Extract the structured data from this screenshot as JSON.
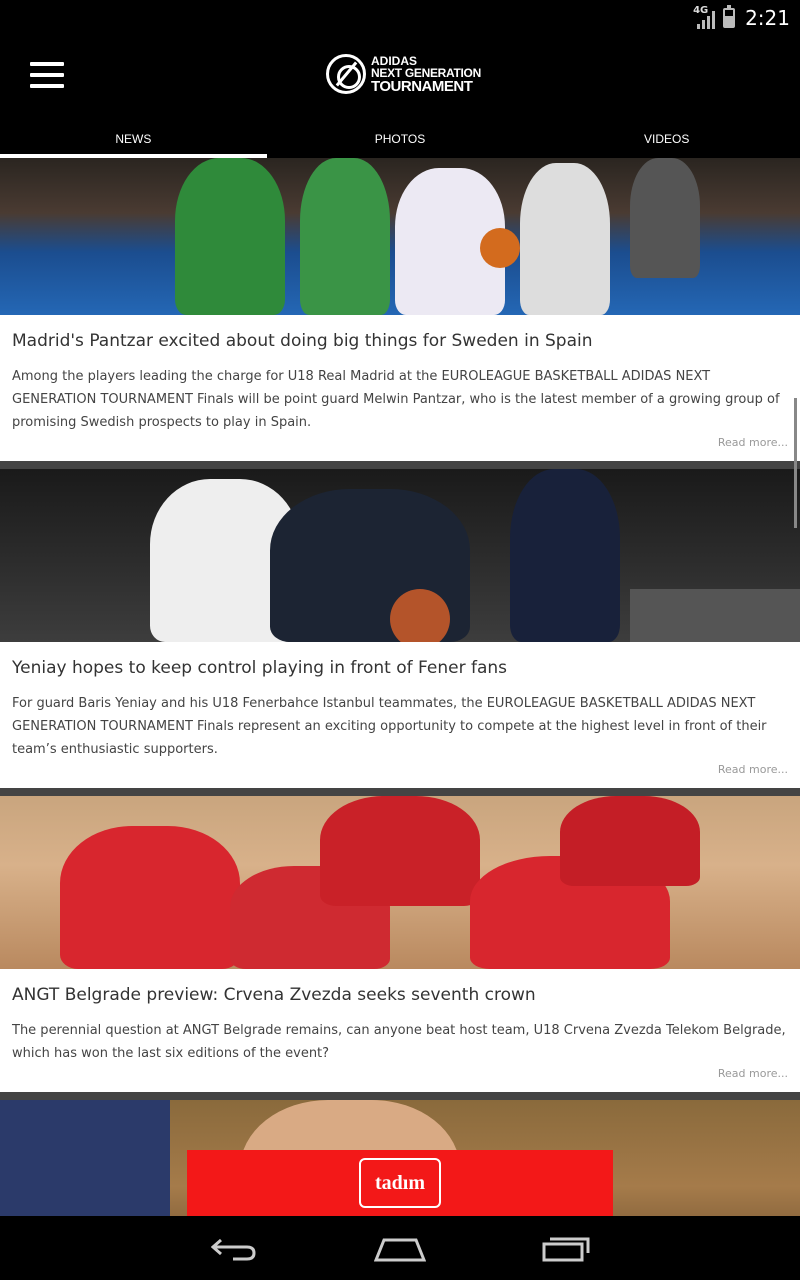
{
  "status_bar": {
    "network": "4G",
    "time": "2:21"
  },
  "app_bar": {
    "logo_lines": [
      "ADIDAS",
      "NEXT GENERATION",
      "TOURNAMENT"
    ]
  },
  "tabs": [
    {
      "label": "NEWS",
      "active": true
    },
    {
      "label": "PHOTOS",
      "active": false
    },
    {
      "label": "VIDEOS",
      "active": false
    }
  ],
  "articles": [
    {
      "title": "Madrid's Pantzar excited about doing big things for Sweden in Spain",
      "summary": "Among the players leading the charge for U18 Real Madrid at the EUROLEAGUE BASKETBALL ADIDAS NEXT GENERATION TOURNAMENT Finals will be point guard Melwin Pantzar, who is the latest member of a growing group of promising Swedish prospects to play in Spain.",
      "read_more": "Read more..."
    },
    {
      "title": "Yeniay hopes to keep control playing in front of Fener fans",
      "summary": "For guard Baris Yeniay and his U18 Fenerbahce Istanbul teammates, the EUROLEAGUE BASKETBALL ADIDAS NEXT GENERATION TOURNAMENT Finals represent an exciting opportunity to compete at the highest level in front of their team’s enthusiastic supporters.",
      "read_more": "Read more..."
    },
    {
      "title": "ANGT Belgrade preview: Crvena Zvezda seeks seventh crown",
      "summary": "The perennial question at ANGT Belgrade remains, can anyone beat host team, U18 Crvena Zvezda Telekom Belgrade, which has won the last six editions of the event?",
      "read_more": "Read more..."
    }
  ],
  "ad": {
    "brand": "tadım"
  },
  "colors": {
    "ad_red": "#f31818",
    "background": "#000000"
  }
}
